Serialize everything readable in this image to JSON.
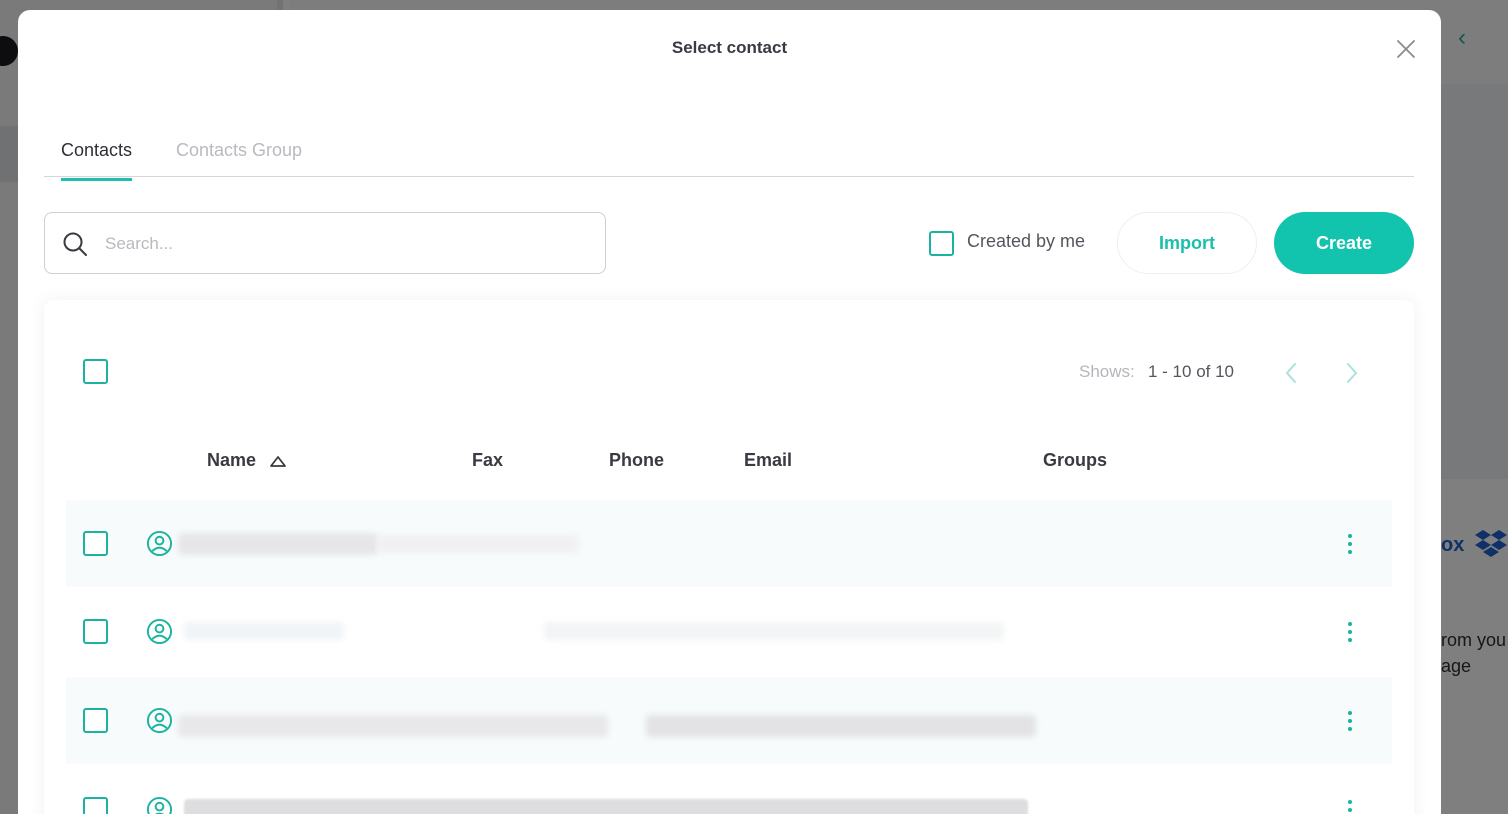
{
  "background": {
    "cloud_brand_fragment": "ox",
    "copy_line1": "rom you",
    "copy_line2": "age"
  },
  "modal": {
    "title": "Select contact"
  },
  "tabs": [
    {
      "label": "Contacts",
      "active": true
    },
    {
      "label": "Contacts Group",
      "active": false
    }
  ],
  "toolbar": {
    "search_placeholder": "Search...",
    "created_by_me_label": "Created by me",
    "import_label": "Import",
    "create_label": "Create"
  },
  "pagination": {
    "shows_label": "Shows:",
    "range": "1 - 10 of 10"
  },
  "table": {
    "columns": [
      "Name",
      "Fax",
      "Phone",
      "Email",
      "Groups"
    ],
    "sorted_by": "Name",
    "sort_direction": "ascending"
  },
  "colors": {
    "accent": "#12c3ad",
    "text": "#2e2e35",
    "muted": "#b9b9bf"
  }
}
